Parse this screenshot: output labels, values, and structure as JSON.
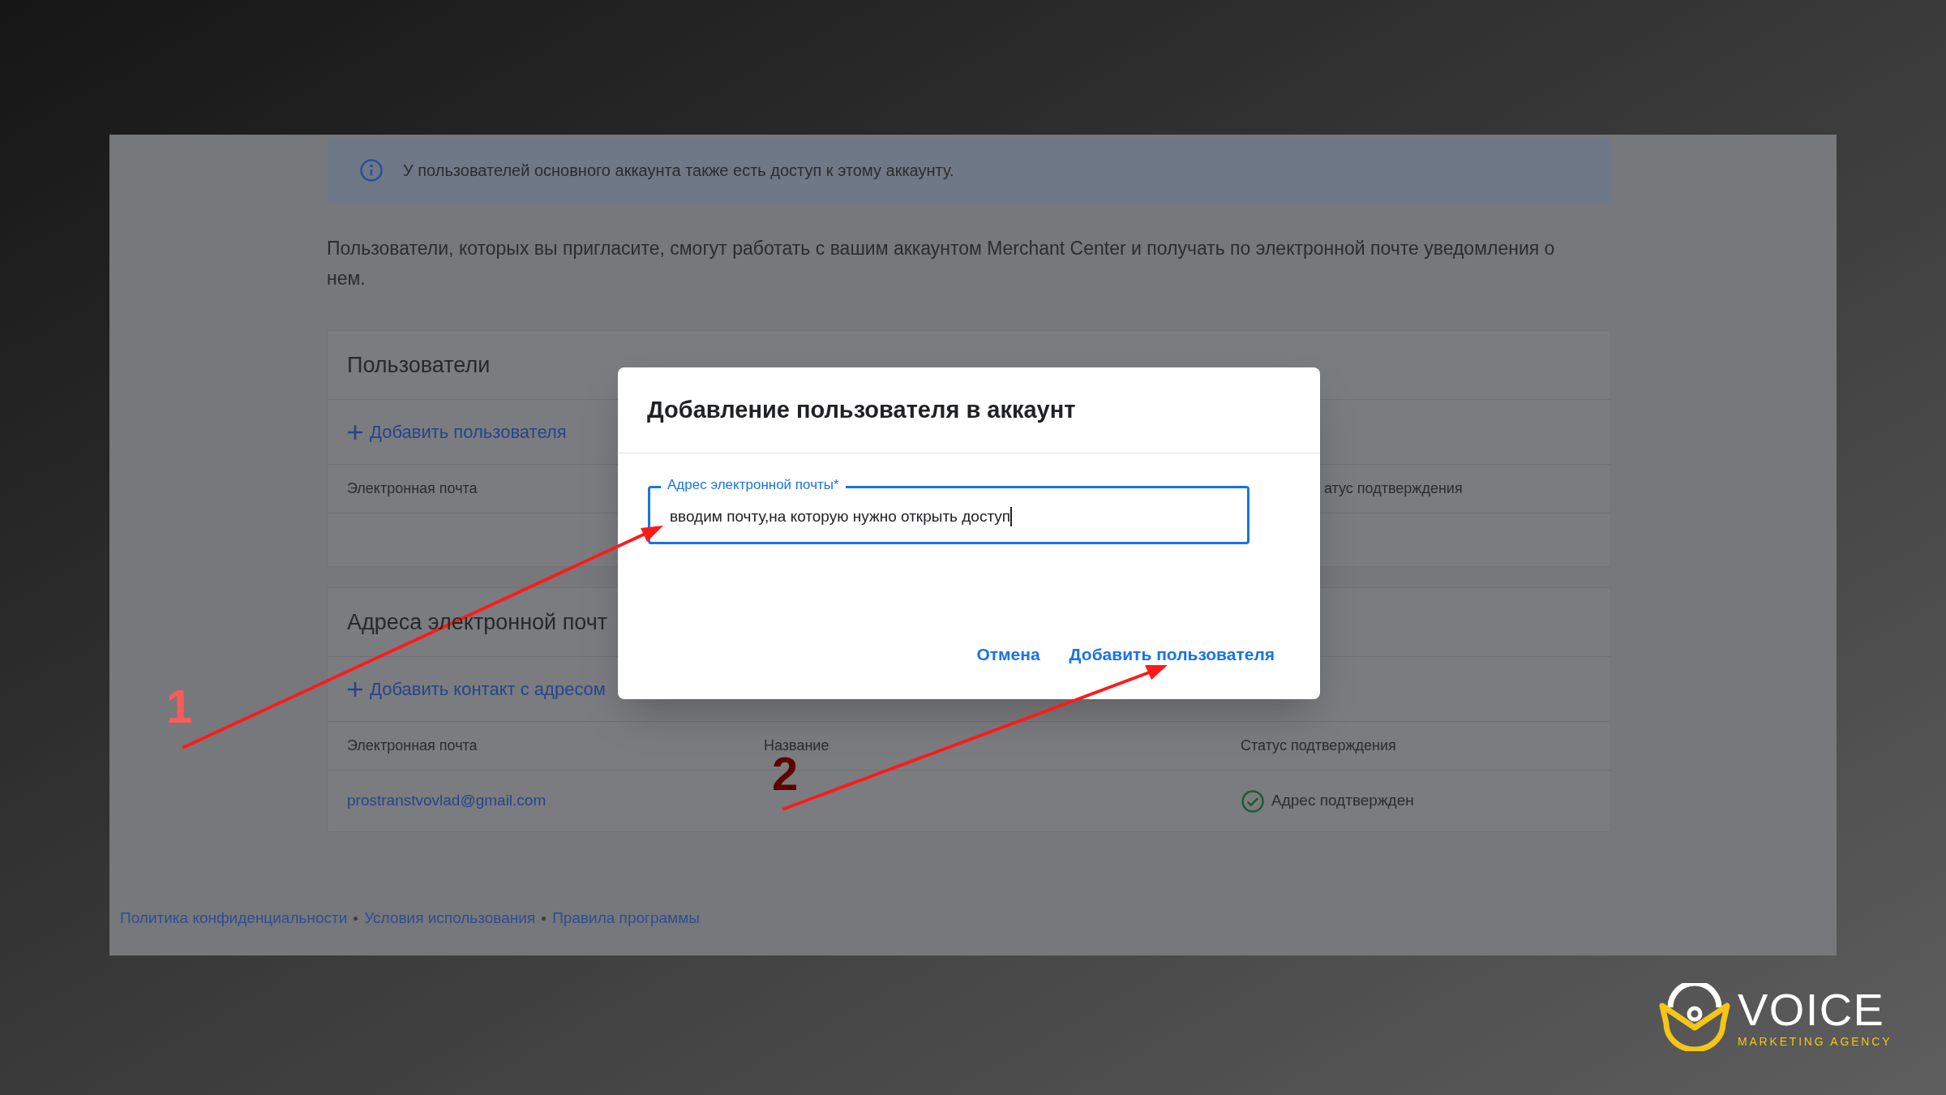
{
  "info_banner": {
    "text": "У пользователей основного аккаунта также есть доступ к этому аккаунту."
  },
  "description": "Пользователи, которых вы пригласите, смогут работать с вашим аккаунтом Merchant Center и получать по электронной почте уведомления о нем.",
  "users_card": {
    "title": "Пользователи",
    "add_action": "Добавить пользователя",
    "columns": [
      "Электронная почта",
      "атус подтверждения"
    ]
  },
  "emails_card": {
    "title": "Адреса электронной почт",
    "add_action": "Добавить контакт с адресом",
    "columns": [
      "Электронная почта",
      "Название",
      "Статус подтверждения"
    ],
    "rows": [
      {
        "email": "prostranstvovlad@gmail.com",
        "status": "Адрес подтвержден",
        "verified": true
      }
    ]
  },
  "footer_links": [
    "Политика конфиденциальности",
    "Условия использования",
    "Правила программы"
  ],
  "dialog": {
    "title": "Добавление пользователя в аккаунт",
    "field": {
      "label": "Адрес электронной почты*",
      "value": "вводим почту,на которую нужно открыть доступ",
      "focused": true
    },
    "buttons": [
      "Отмена",
      "Добавить пользователя"
    ]
  },
  "annotations": [
    "1",
    "2"
  ],
  "logo": {
    "name": "VOICE",
    "tagline": "MARKETING AGENCY"
  }
}
